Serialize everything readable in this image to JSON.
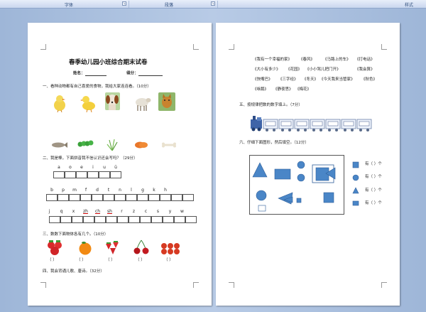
{
  "ribbon": {
    "groups": [
      "字体",
      "段落",
      "样式"
    ]
  },
  "left_page": {
    "title": "春季幼儿园小班综合期末试卷",
    "name_label": "姓名",
    "score_label": "得分",
    "q1": "一、看种动物都有自己喜爱的食物，我给大家连连看。（10分）",
    "q2": "二、我是棒，下面拼音我不信认识还会写吗？（29分）",
    "pinyin_row1": [
      "a",
      "o",
      "e",
      "i",
      "u",
      "ü"
    ],
    "pinyin_row2": [
      "b",
      "p",
      "m",
      "f",
      "d",
      "t",
      "n",
      "l",
      "g",
      "k",
      "h"
    ],
    "pinyin_row3": [
      "j",
      "q",
      "x",
      "zh",
      "ch",
      "sh",
      "r",
      "z",
      "c",
      "s",
      "y",
      "w"
    ],
    "q3": "三、数数下面物体各有几个。（10分）",
    "brackets": [
      "（   ）",
      "（   ）",
      "（   ）",
      "（   ）",
      "（   ）"
    ],
    "q4": "四、我会背诵儿歌、唐诗。（32分）"
  },
  "right_page": {
    "poems": [
      [
        "《我有一个幸福的家》",
        "《春风》",
        "《马路上的车》",
        "《打电话》"
      ],
      [
        "《大小有多少》",
        "《花园》",
        "《小小驾儿把门开》",
        "《我会算》"
      ],
      [
        "《快嘴巴》",
        "《三字经》",
        "《冬天》",
        "《今天我来当管家》",
        "《秋色》"
      ],
      [
        "《咏鹅》",
        "《静夜思》",
        "《梅花》"
      ]
    ],
    "q5": "五、按规律把数的数字填上。（7分）",
    "q6": "六、仔细下面图形，然后填空。（12分）",
    "counts": [
      "有（   ）个",
      "有（   ）个",
      "有（   ）个",
      "有（   ）个"
    ],
    "colors": {
      "shape_blue": "#4a86c7"
    }
  }
}
